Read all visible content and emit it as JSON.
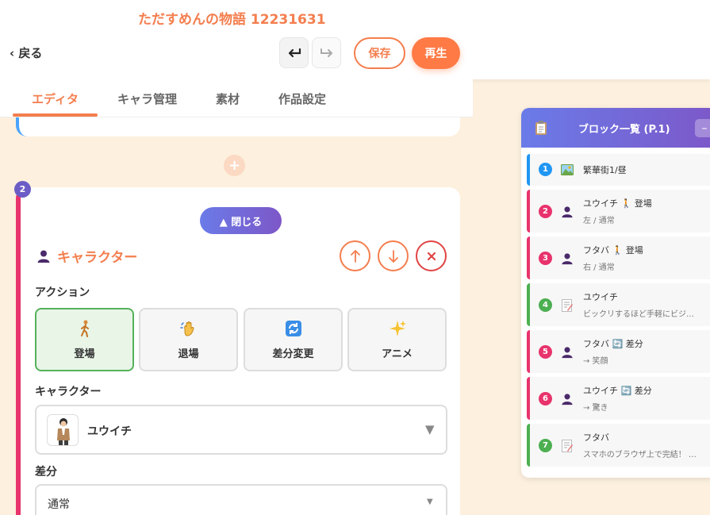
{
  "header": {
    "title": "ただすめんの物語 12231631",
    "back_label": "‹ 戻る",
    "undo_icon": "undo-icon",
    "redo_icon": "redo-icon",
    "save_label": "保存",
    "play_label": "再生"
  },
  "tabs": [
    {
      "label": "エディタ",
      "active": true
    },
    {
      "label": "キャラ管理",
      "active": false
    },
    {
      "label": "素材",
      "active": false
    },
    {
      "label": "作品設定",
      "active": false
    }
  ],
  "add_block_label": "+",
  "block": {
    "number": "2",
    "close_label": "▲ 閉じる",
    "title": "キャラクター",
    "move_up_label": "↑",
    "move_down_label": "↓",
    "delete_label": "×",
    "action_label": "アクション",
    "actions": [
      {
        "label": "登場",
        "selected": true
      },
      {
        "label": "退場",
        "selected": false
      },
      {
        "label": "差分変更",
        "selected": false
      },
      {
        "label": "アニメ",
        "selected": false
      }
    ],
    "character_label": "キャラクター",
    "character_value": "ユウイチ",
    "diff_label": "差分",
    "diff_value": "通常"
  },
  "block_list": {
    "title": "ブロック一覧 (P.1)",
    "minimize_label": "–",
    "items": [
      {
        "num": "1",
        "icon": "image-icon",
        "line1": "繁華街1/昼",
        "line2": "",
        "accent": "#2196f3"
      },
      {
        "num": "2",
        "icon": "person-icon",
        "line1": "ユウイチ 🚶 登場",
        "line2": "左 / 通常",
        "accent": "#e8336c"
      },
      {
        "num": "3",
        "icon": "person-icon",
        "line1": "フタバ 🚶 登場",
        "line2": "右 / 通常",
        "accent": "#e8336c"
      },
      {
        "num": "4",
        "icon": "memo-icon",
        "line1": "ユウイチ",
        "line2": "ビックリするほど手軽にビジ…",
        "accent": "#4caf50"
      },
      {
        "num": "5",
        "icon": "person-icon",
        "line1": "フタバ 🔄 差分",
        "line2": "→ 笑顔",
        "accent": "#e8336c"
      },
      {
        "num": "6",
        "icon": "person-icon",
        "line1": "ユウイチ 🔄 差分",
        "line2": "→ 驚き",
        "accent": "#e8336c"
      },
      {
        "num": "7",
        "icon": "memo-icon",
        "line1": "フタバ",
        "line2": "スマホのブラウザ上で完結！ …",
        "accent": "#4caf50"
      }
    ]
  },
  "colors": {
    "accent": "#f47e4e",
    "purple": "#6c5cc6",
    "char_block": "#e8336c",
    "scene_block": "#2196f3",
    "text_block": "#4caf50"
  }
}
